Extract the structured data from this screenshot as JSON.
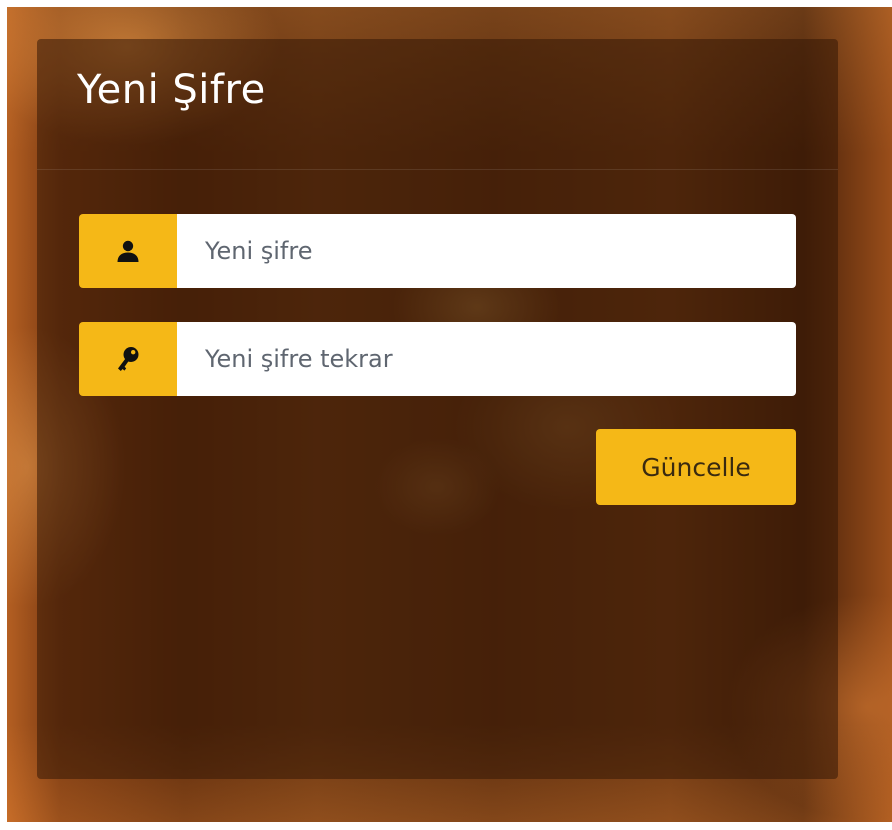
{
  "form": {
    "title": "Yeni Şifre",
    "new_password": {
      "icon": "user-icon",
      "placeholder": "Yeni şifre",
      "value": ""
    },
    "confirm_password": {
      "icon": "key-icon",
      "placeholder": "Yeni şifre tekrar",
      "value": ""
    },
    "submit_label": "Güncelle"
  },
  "colors": {
    "accent": "#f5b817",
    "title_text": "#ffffff",
    "panel_overlay": "rgba(52,24,6,0.55)"
  }
}
